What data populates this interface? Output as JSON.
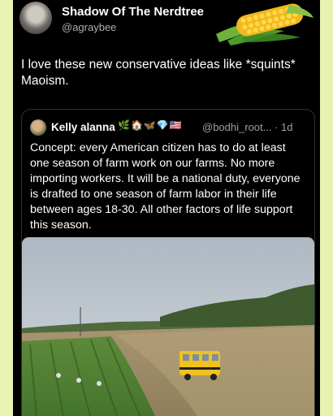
{
  "tweet": {
    "display_name": "Shadow Of The Nerdtree",
    "handle": "@agraybee",
    "text": "I love these new conservative ideas like *squints* Maoism."
  },
  "quoted_tweet": {
    "display_name": "Kelly alanna",
    "name_emojis": "🌿🏠🦋💎🇺🇸",
    "handle_time": "@bodhi_root... · 1d",
    "text": "Concept: every American citizen has to do at least one season of farm work on our farms. No more importing workers. It will be a national duty, everyone is drafted to one season of farm labor in their life between ages 18-30. All other factors of life support this season."
  },
  "colors": {
    "page_bg": "#e7f3b0",
    "card_bg": "#000000",
    "secondary_text": "#a9adb3",
    "border": "#2f3336"
  },
  "icons": [
    "user-avatar",
    "corn-sticker",
    "quoted-user-avatar",
    "farm-photo"
  ]
}
